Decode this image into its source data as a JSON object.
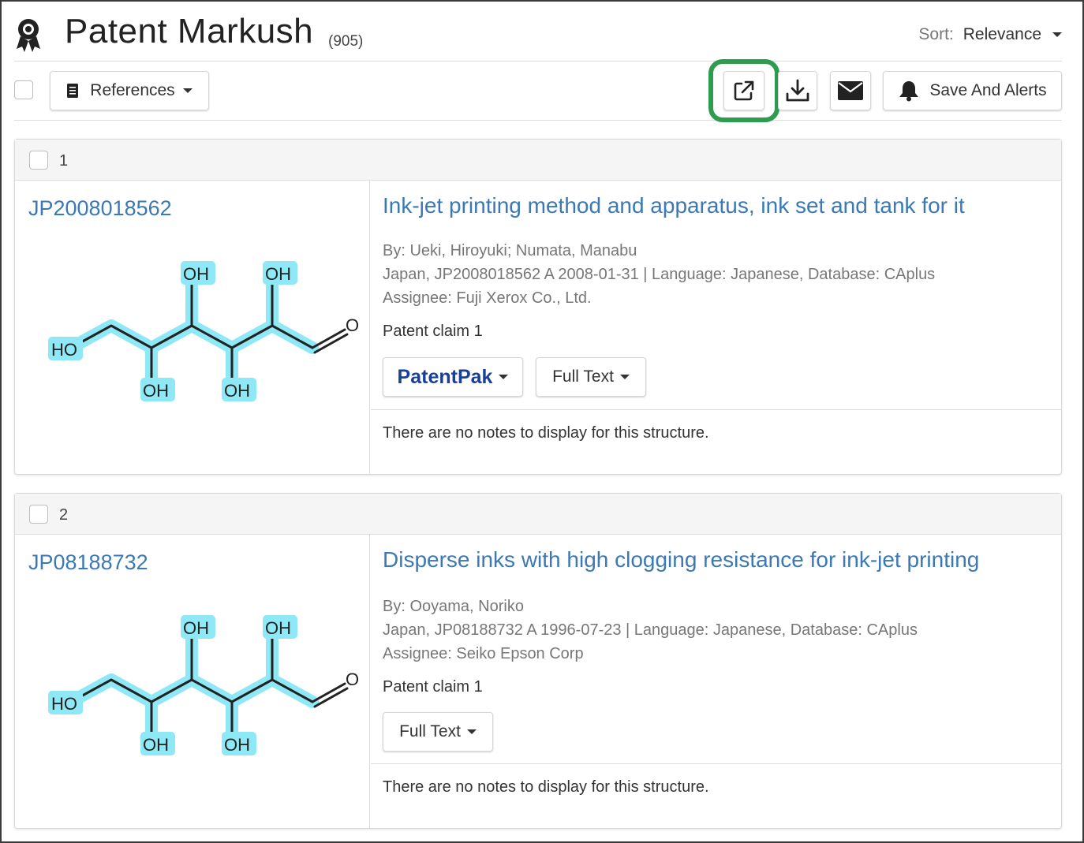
{
  "header": {
    "title": "Patent Markush",
    "count": "(905)",
    "sort_label": "Sort:",
    "sort_value": "Relevance"
  },
  "toolbar": {
    "references_label": "References",
    "save_alerts_label": "Save And Alerts"
  },
  "colors": {
    "link": "#3a79b6",
    "patentpak": "#1a3f96",
    "highlight_box": "#2e9c4f",
    "structure_highlight": "#8ee8f5"
  },
  "results": [
    {
      "index": "1",
      "patent_id": "JP2008018562",
      "title": "Ink-jet printing method and apparatus, ink set and tank for it",
      "authors": "By: Ueki, Hiroyuki; Numata, Manabu",
      "publication": "Japan, JP2008018562 A 2008-01-31 | Language: Japanese, Database: CAplus",
      "assignee": "Assignee: Fuji Xerox Co., Ltd.",
      "claim": "Patent claim 1",
      "patentpak_label": "PatentPak",
      "full_text_label": "Full Text",
      "notes": "There are no notes to display for this structure.",
      "structure_labels": {
        "ho": "HO",
        "oh": "OH",
        "o": "O"
      }
    },
    {
      "index": "2",
      "patent_id": "JP08188732",
      "title": "Disperse inks with high clogging resistance for ink-jet printing",
      "authors": "By: Ooyama, Noriko",
      "publication": "Japan, JP08188732 A 1996-07-23 | Language: Japanese, Database: CAplus",
      "assignee": "Assignee: Seiko Epson Corp",
      "claim": "Patent claim 1",
      "full_text_label": "Full Text",
      "notes": "There are no notes to display for this structure.",
      "structure_labels": {
        "ho": "HO",
        "oh": "OH",
        "o": "O"
      }
    }
  ]
}
